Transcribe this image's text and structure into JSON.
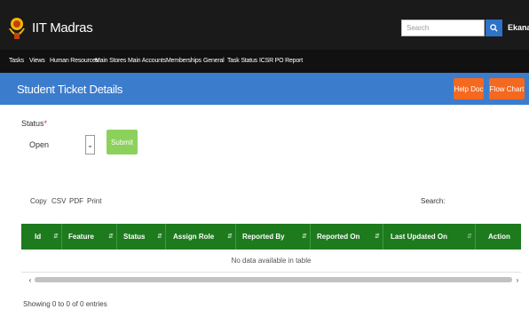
{
  "header": {
    "brand": "IIT Madras",
    "search_placeholder": "Search",
    "user_name": "Ekanalai"
  },
  "nav": {
    "items": [
      "Tasks",
      "Views",
      "Human Resources",
      "Main Stores",
      "Main Accounts",
      "Memberships",
      "General",
      "Task Status",
      "ICSR PO Report"
    ]
  },
  "page": {
    "title": "Student Ticket Details",
    "help_doc_label": "Help Doc",
    "flow_chart_label": "Flow Chart"
  },
  "filter": {
    "status_label": "Status",
    "required_mark": "*",
    "status_value": "Open",
    "submit_label": "Submit"
  },
  "table_tools": {
    "buttons": [
      "Copy",
      "CSV",
      "PDF",
      "Print"
    ],
    "search_label": "Search:"
  },
  "table": {
    "columns": [
      "Id",
      "Feature",
      "Status",
      "Assign Role",
      "Reported By",
      "Reported On",
      "Last Updated On",
      "Action"
    ],
    "empty_message": "No data available in table"
  },
  "footer": {
    "info": "Showing 0 to 0 of 0 entries"
  },
  "colors": {
    "topbar": "#1a1a1a",
    "title_bar": "#3c7ccc",
    "table_header": "#1d7a1d",
    "orange_button": "#f5681f",
    "submit_button": "#8cd15c"
  },
  "icons": {
    "logo": "iit-madras-emblem",
    "search": "search-icon",
    "dropdown": "chevron-down-icon",
    "sort": "sort-icon"
  }
}
